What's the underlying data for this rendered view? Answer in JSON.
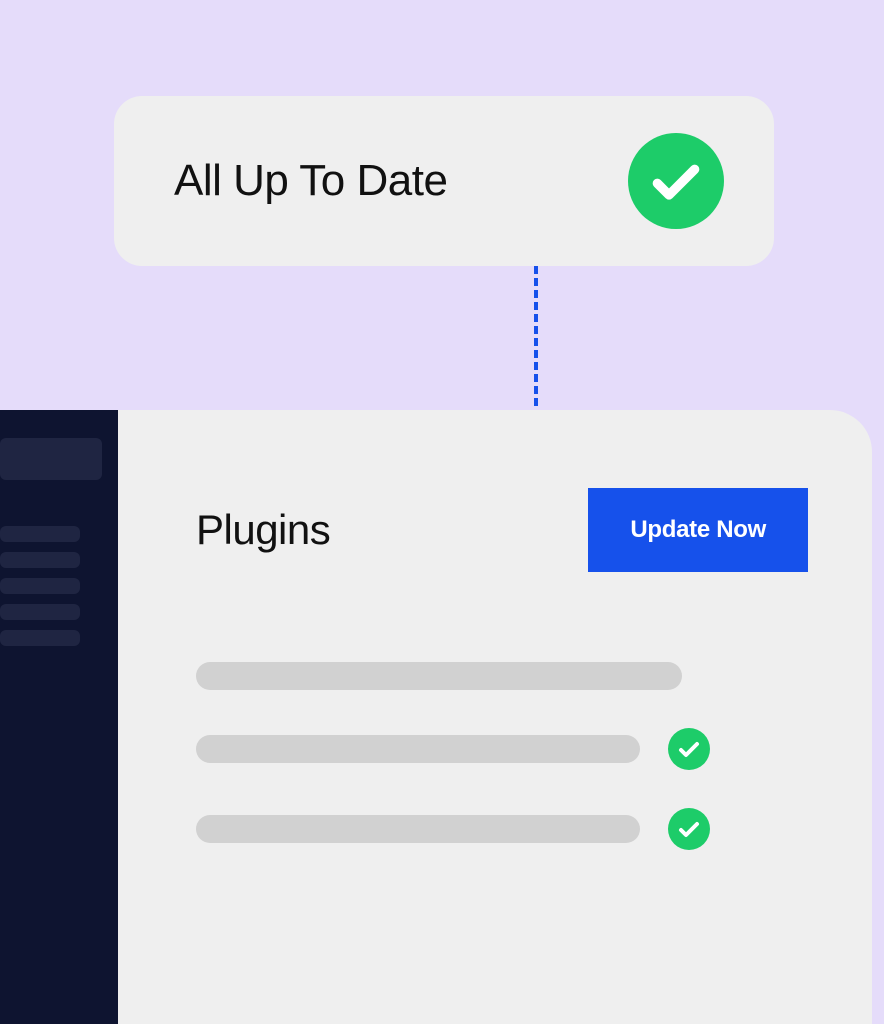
{
  "status": {
    "label": "All Up To Date"
  },
  "panel": {
    "title": "Plugins",
    "button_label": "Update Now"
  }
}
